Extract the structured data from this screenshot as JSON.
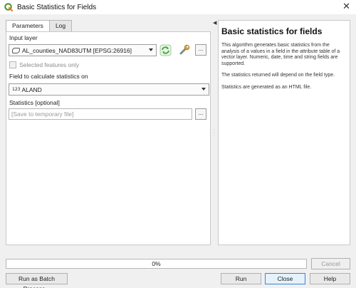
{
  "window": {
    "title": "Basic Statistics for Fields",
    "close_glyph": "✕"
  },
  "tabs": [
    {
      "label": "Parameters"
    },
    {
      "label": "Log"
    }
  ],
  "params": {
    "input_layer_label": "Input layer",
    "input_layer_value": "AL_counties_NAD83UTM [EPSG:26916]",
    "selected_only_label": "Selected features only",
    "field_label": "Field to calculate statistics on",
    "field_type_badge": "123",
    "field_value": "ALAND",
    "statistics_label": "Statistics [optional]",
    "statistics_placeholder": "[Save to temporary file]",
    "browse_label": "..."
  },
  "help": {
    "title": "Basic statistics for fields",
    "paragraph1": "This algorithm generates basic statistics from the analysis of a values in a field in the attribute table of a vector layer. Numeric, date, time and string fields are supported.",
    "paragraph2": "The statistics returned will depend on the field type.",
    "paragraph3": "Statistics are generated as an HTML file."
  },
  "progress": {
    "value": 0,
    "label": "0%"
  },
  "buttons": {
    "cancel": "Cancel",
    "batch": "Run as Batch Process...",
    "run": "Run",
    "close": "Close",
    "help": "Help"
  },
  "colors": {
    "qgis_green": "#589632",
    "iterate_green": "#3fa33f",
    "accent_blue": "#3c84d6"
  }
}
